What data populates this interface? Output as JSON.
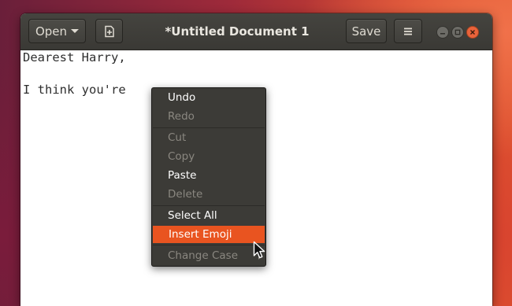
{
  "header": {
    "open_label": "Open",
    "title": "*Untitled Document 1",
    "save_label": "Save"
  },
  "editor": {
    "lines": [
      "Dearest Harry,",
      "I think you're"
    ]
  },
  "context_menu": {
    "items": [
      {
        "label": "Undo",
        "enabled": true
      },
      {
        "label": "Redo",
        "enabled": false
      },
      {
        "label": "Cut",
        "enabled": false
      },
      {
        "label": "Copy",
        "enabled": false
      },
      {
        "label": "Paste",
        "enabled": true
      },
      {
        "label": "Delete",
        "enabled": false
      },
      {
        "label": "Select All",
        "enabled": true
      },
      {
        "label": "Insert Emoji",
        "enabled": true,
        "highlighted": true
      },
      {
        "label": "Change Case",
        "enabled": false,
        "submenu": true
      }
    ]
  },
  "icons": {
    "new_document": "new-document-icon",
    "hamburger": "hamburger-menu-icon",
    "minimize": "minimize-icon",
    "maximize": "maximize-icon",
    "close": "close-icon",
    "submenu": "chevron-right-icon",
    "pointer": "mouse-pointer-icon"
  },
  "colors": {
    "accent": "#e95420",
    "headerbar": "#3c3b37",
    "menu_bg": "#3c3b37"
  }
}
